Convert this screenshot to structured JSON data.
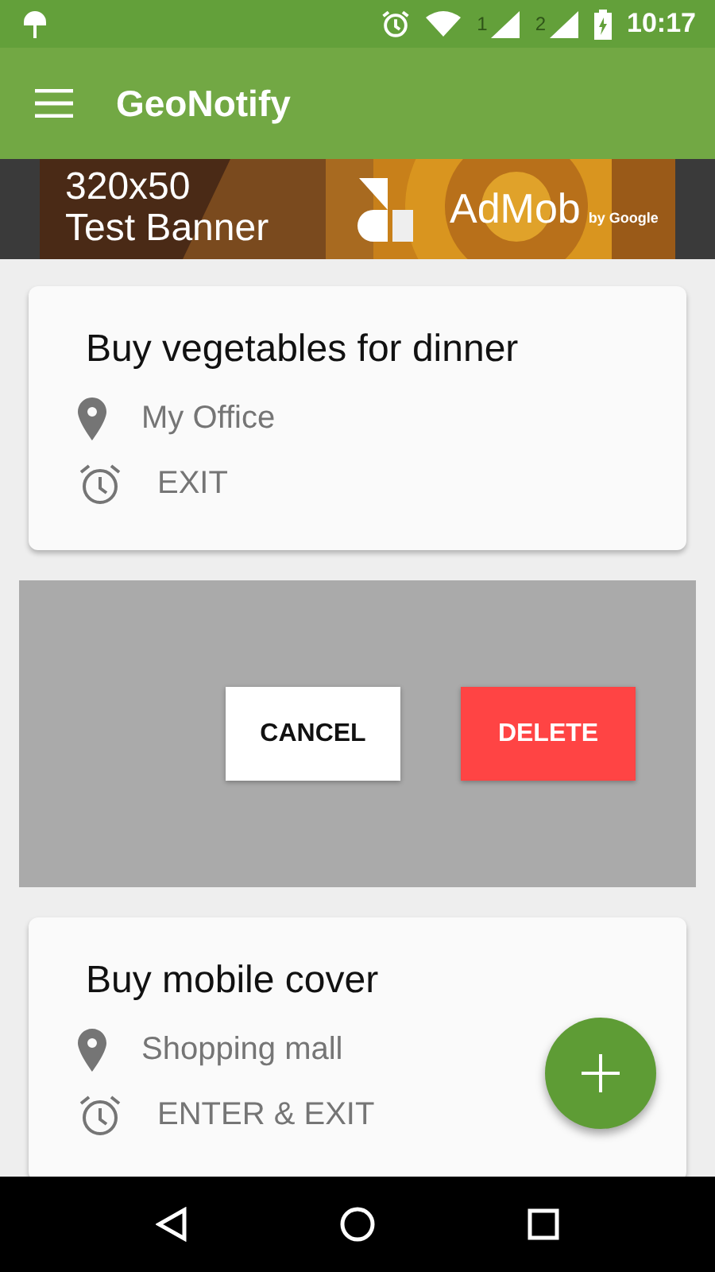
{
  "status_bar": {
    "time": "10:17",
    "sim_slots": [
      "1",
      "2"
    ]
  },
  "app_bar": {
    "title": "GeoNotify"
  },
  "ad_banner": {
    "size": "320x50",
    "label": "Test Banner",
    "brand": "AdMob",
    "byline": "by Google"
  },
  "items": [
    {
      "kind": "reminder",
      "title": "Buy vegetables for dinner",
      "place": "My Office",
      "trigger": "EXIT"
    },
    {
      "kind": "confirm",
      "buttons": [
        {
          "kind": "cancel",
          "label": "CANCEL"
        },
        {
          "kind": "delete",
          "label": "DELETE"
        }
      ]
    },
    {
      "kind": "reminder",
      "title": "Buy mobile cover",
      "place": "Shopping mall",
      "trigger": "ENTER & EXIT"
    }
  ]
}
